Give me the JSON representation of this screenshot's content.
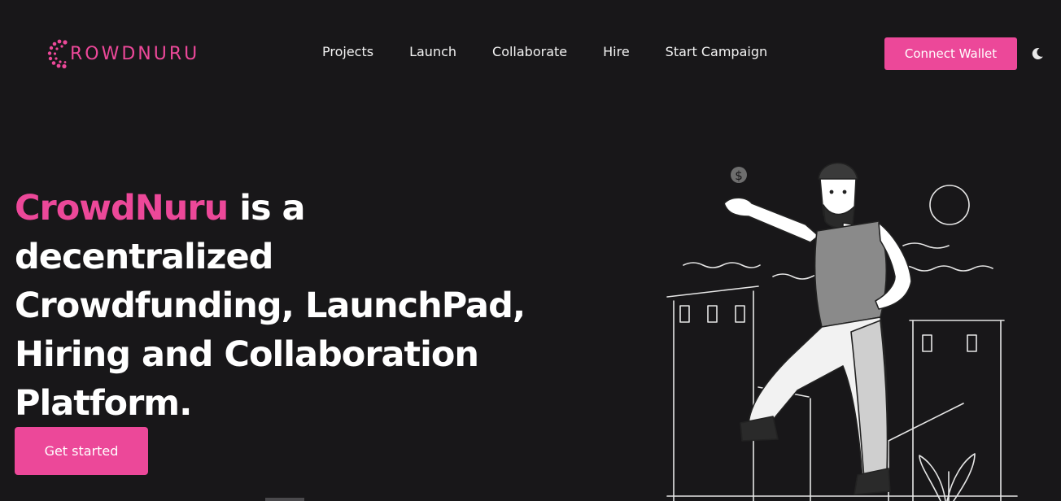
{
  "header": {
    "logo_text": "ROWDNURU",
    "nav": [
      {
        "label": "Projects"
      },
      {
        "label": "Launch"
      },
      {
        "label": "Collaborate"
      },
      {
        "label": "Hire"
      },
      {
        "label": "Start Campaign"
      }
    ],
    "connect_wallet_label": "Connect Wallet",
    "theme_toggle_icon": "moon-icon"
  },
  "hero": {
    "title_brand": "CrowdNuru",
    "title_rest": " is a decentralized Crowdfunding, LaunchPad, Hiring and Collaboration Platform.",
    "cta_label": "Get started",
    "coin_symbol": "$"
  },
  "colors": {
    "background": "#181719",
    "accent": "#ec4899",
    "text": "#ffffff"
  }
}
